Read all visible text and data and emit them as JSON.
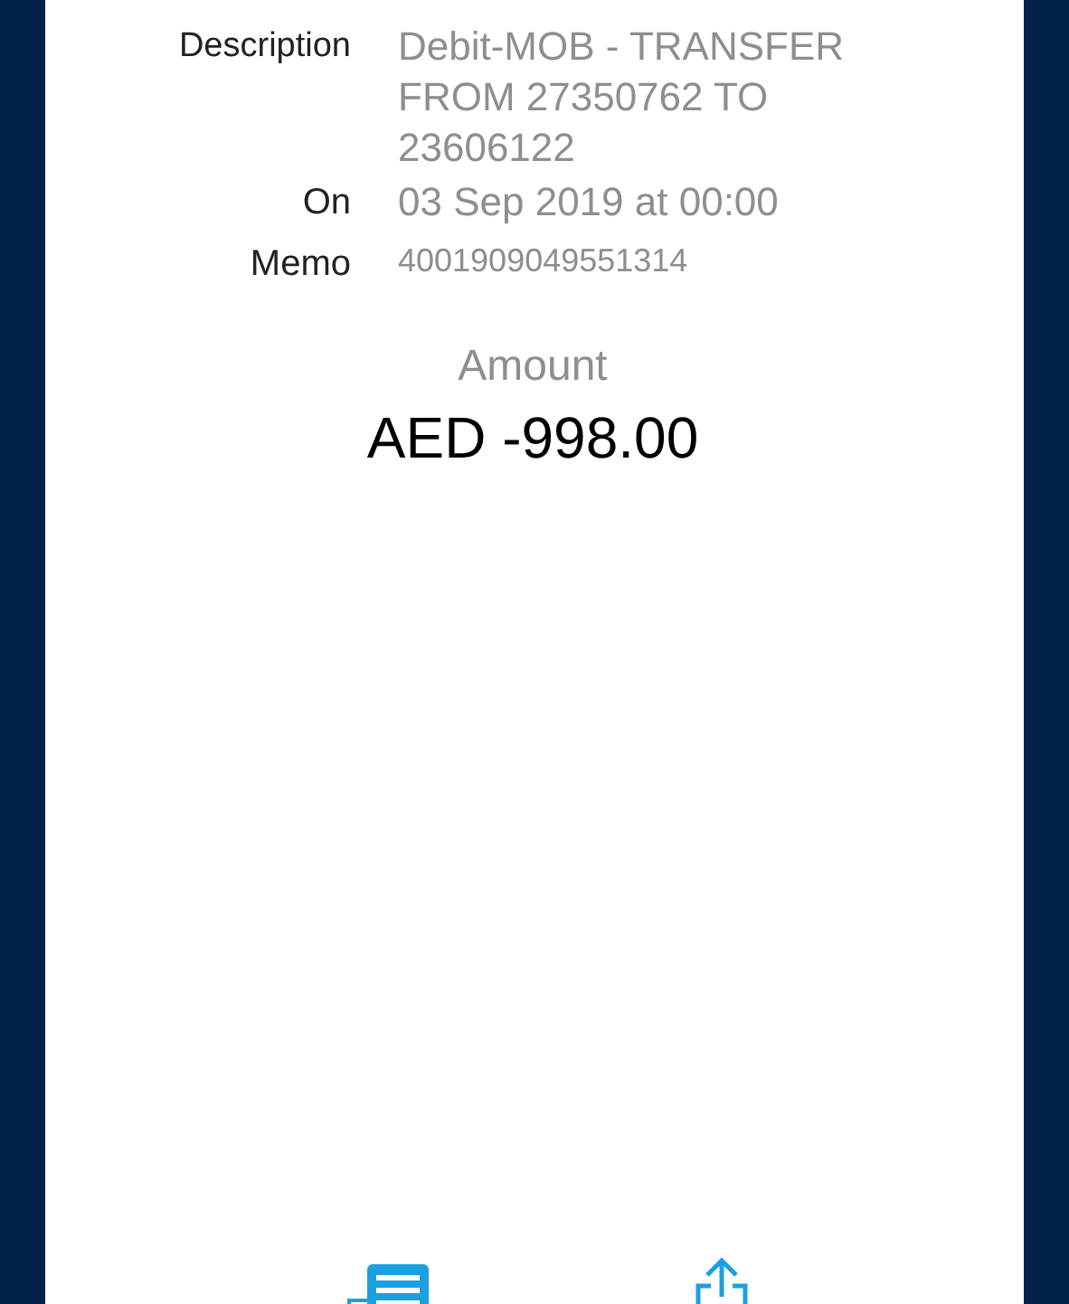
{
  "details": [
    {
      "label": "Description",
      "value": "Debit-MOB - TRANSFER FROM 27350762 TO 23606122",
      "kind": "large"
    },
    {
      "label": "On",
      "value": "03 Sep 2019 at 00:00",
      "kind": "large"
    },
    {
      "label": "Memo",
      "value": "4001909049551314",
      "kind": "small"
    }
  ],
  "amount": {
    "label": "Amount",
    "value": "AED -998.00"
  }
}
